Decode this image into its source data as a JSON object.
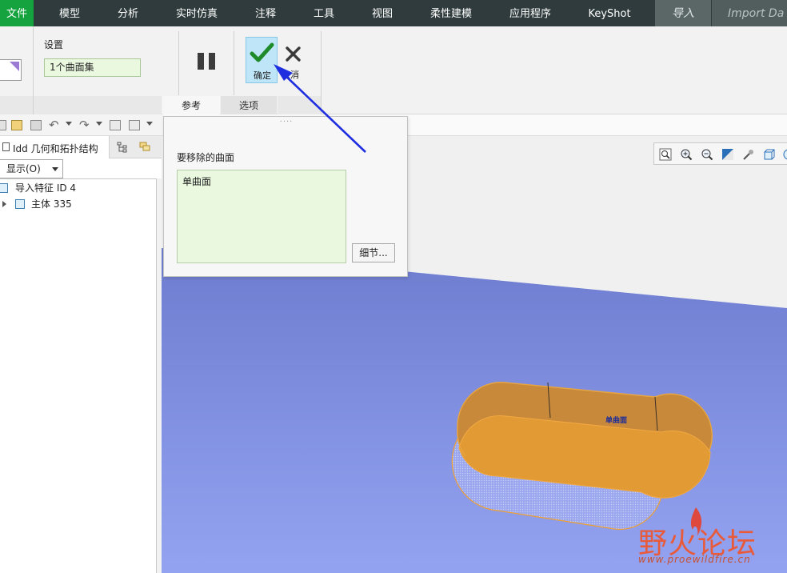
{
  "menubar": {
    "file": "文件",
    "model": "模型",
    "analysis": "分析",
    "live_sim": "实时仿真",
    "annotate": "注释",
    "tools": "工具",
    "view": "视图",
    "flexible": "柔性建模",
    "apps": "应用程序",
    "keyshot": "KeyShot",
    "import": "导入",
    "import_data": "Import Da"
  },
  "ribbon": {
    "settings_label": "设置",
    "settings_value": "1个曲面集",
    "ok_label": "确定",
    "cancel_label": "取消",
    "tabs": {
      "references": "参考",
      "options": "选项"
    }
  },
  "model_tree": {
    "tab_label": "Idd 几何和拓扑结构",
    "display_label": "显示(O)",
    "items": [
      {
        "label": "导入特征 ID 4"
      },
      {
        "label": "主体 335"
      }
    ]
  },
  "popup": {
    "dots": "····",
    "label": "要移除的曲面",
    "list_item": "单曲面",
    "details_button": "细节..."
  },
  "graphics": {
    "annotation": "单曲面"
  },
  "watermark": {
    "main": "野火论坛",
    "url": "www.proewildfire.cn"
  },
  "colors": {
    "menubar_bg": "#2f3b3c",
    "file_tab": "#14a33f",
    "viewport_blue": "#7f8ee0",
    "surface_orange": "#e29a35",
    "arrow_blue": "#1f2fe0"
  },
  "icons": [
    "pause-icon",
    "check-icon",
    "close-icon",
    "zoom-fit-icon",
    "zoom-in-icon",
    "zoom-out-icon",
    "repaint-icon",
    "view-orient-icon",
    "cube-view-icon"
  ]
}
